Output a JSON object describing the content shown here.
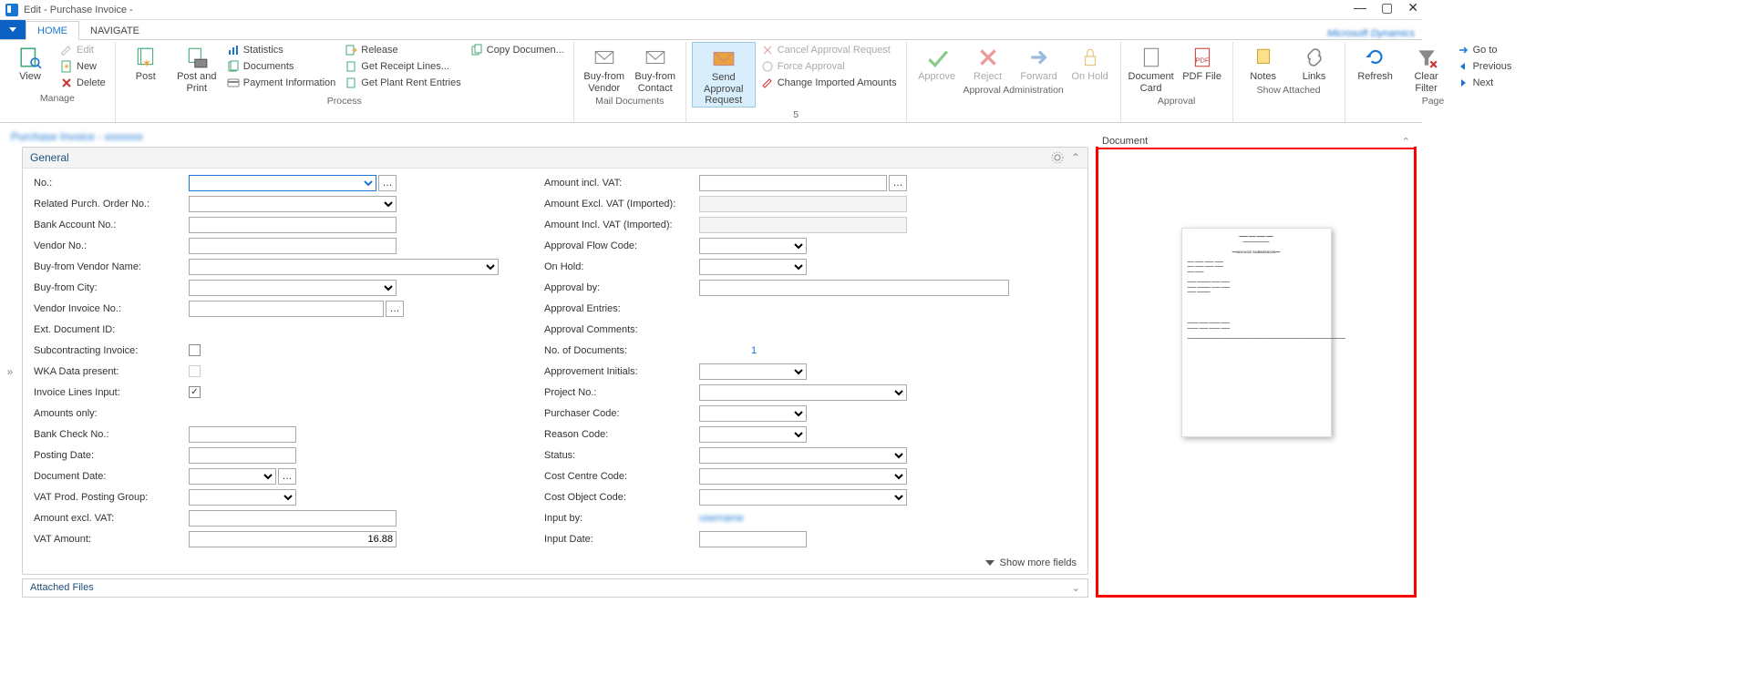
{
  "window": {
    "title": "Edit - Purchase Invoice - ",
    "tabs": {
      "file_caret": "▾",
      "home": "HOME",
      "navigate": "NAVIGATE"
    }
  },
  "ribbon": {
    "manage": {
      "label": "Manage",
      "view": "View",
      "edit": "Edit",
      "new": "New",
      "delete": "Delete"
    },
    "process": {
      "label": "Process",
      "post": "Post",
      "post_and_print": "Post and Print",
      "statistics": "Statistics",
      "documents": "Documents",
      "payment_info": "Payment Information",
      "release": "Release",
      "get_receipt": "Get Receipt Lines...",
      "get_plant": "Get Plant Rent Entries",
      "copy_doc": "Copy Documen..."
    },
    "mail_docs": {
      "label": "Mail Documents",
      "buy_from_vendor": "Buy-from Vendor",
      "buy_from_contact": "Buy-from Contact"
    },
    "five": {
      "label": "5",
      "send_approval": "Send Approval Request",
      "cancel_approval": "Cancel Approval Request",
      "force_approval": "Force Approval",
      "change_imported": "Change Imported Amounts"
    },
    "approval_admin": {
      "label": "Approval Administration",
      "approve": "Approve",
      "reject": "Reject",
      "forward": "Forward",
      "on_hold": "On Hold"
    },
    "approval": {
      "label": "Approval",
      "document_card": "Document Card",
      "pdf_file": "PDF File"
    },
    "show_attached": {
      "label": "Show Attached",
      "notes": "Notes",
      "links": "Links"
    },
    "page": {
      "label": "Page",
      "refresh": "Refresh",
      "clear_filter": "Clear Filter",
      "goto": "Go to",
      "previous": "Previous",
      "next": "Next"
    }
  },
  "path": "Purchase Invoice - xxxxxxx",
  "panels": {
    "general": "General",
    "attached": "Attached Files",
    "document": "Document",
    "show_more": "Show more fields"
  },
  "form": {
    "left": {
      "no": {
        "label": "No.:",
        "value": ""
      },
      "related_po": {
        "label": "Related Purch. Order No.:",
        "value": ""
      },
      "bank_acct": {
        "label": "Bank Account No.:",
        "value": ""
      },
      "vendor_no": {
        "label": "Vendor No.:",
        "value": ""
      },
      "buy_from_vendor_name": {
        "label": "Buy-from Vendor Name:",
        "value": ""
      },
      "buy_from_city": {
        "label": "Buy-from City:",
        "value": ""
      },
      "vendor_invoice_no": {
        "label": "Vendor Invoice No.:",
        "value": ""
      },
      "ext_doc_id": {
        "label": "Ext. Document ID:",
        "value": ""
      },
      "subcontracting": {
        "label": "Subcontracting Invoice:",
        "checked": false
      },
      "wka": {
        "label": "WKA Data present:",
        "checked": false
      },
      "invoice_lines_input": {
        "label": "Invoice Lines Input:",
        "checked": true
      },
      "amounts_only": {
        "label": "Amounts only:",
        "value": ""
      },
      "bank_check_no": {
        "label": "Bank Check No.:",
        "value": ""
      },
      "posting_date": {
        "label": "Posting Date:",
        "value": ""
      },
      "document_date": {
        "label": "Document Date:",
        "value": ""
      },
      "vat_prod_group": {
        "label": "VAT Prod. Posting Group:",
        "value": ""
      },
      "amount_excl_vat": {
        "label": "Amount excl. VAT:",
        "value": ""
      },
      "vat_amount": {
        "label": "VAT Amount:",
        "value": "16.88"
      }
    },
    "right": {
      "amount_incl_vat": {
        "label": "Amount incl. VAT:",
        "value": ""
      },
      "amount_excl_vat_imp": {
        "label": "Amount Excl. VAT (Imported):",
        "value": ""
      },
      "amount_incl_vat_imp": {
        "label": "Amount Incl. VAT (Imported):",
        "value": ""
      },
      "approval_flow": {
        "label": "Approval Flow Code:",
        "value": ""
      },
      "on_hold": {
        "label": "On Hold:",
        "value": ""
      },
      "approval_by": {
        "label": "Approval by:",
        "value": ""
      },
      "approval_entries": {
        "label": "Approval Entries:"
      },
      "approval_comments": {
        "label": "Approval Comments:"
      },
      "no_of_documents": {
        "label": "No. of Documents:",
        "value": "1"
      },
      "approvement_initials": {
        "label": "Approvement Initials:",
        "value": ""
      },
      "project_no": {
        "label": "Project No.:",
        "value": ""
      },
      "purchaser_code": {
        "label": "Purchaser Code:",
        "value": ""
      },
      "reason_code": {
        "label": "Reason Code:",
        "value": ""
      },
      "status": {
        "label": "Status:",
        "value": ""
      },
      "cost_centre": {
        "label": "Cost Centre Code:",
        "value": ""
      },
      "cost_object": {
        "label": "Cost Object Code:",
        "value": ""
      },
      "input_by": {
        "label": "Input by:",
        "value": ""
      },
      "input_date": {
        "label": "Input Date:",
        "value": ""
      }
    }
  }
}
